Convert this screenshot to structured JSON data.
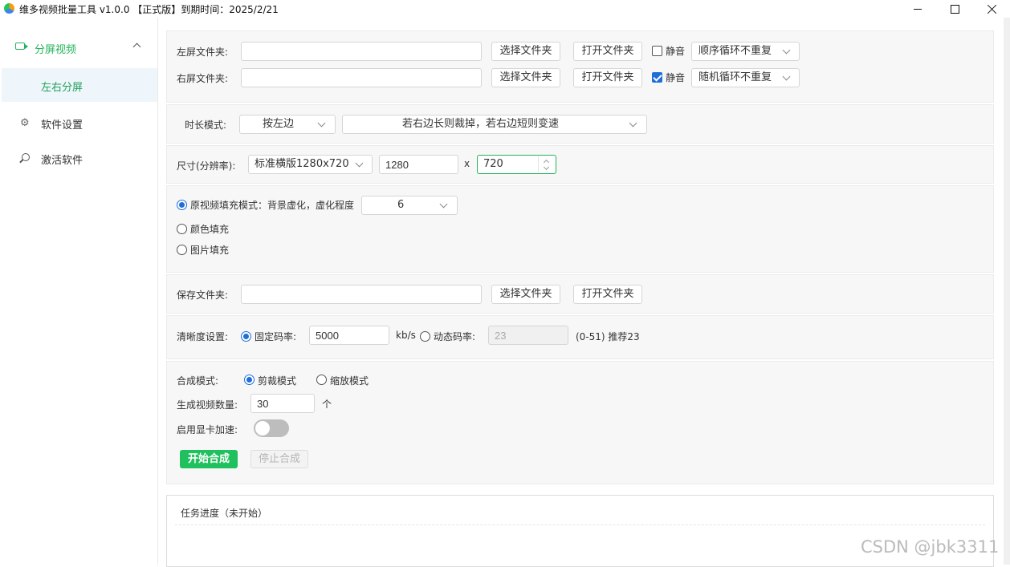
{
  "window": {
    "title": "维多视频批量工具 v1.0.0 【正式版】到期时间：2025/2/21"
  },
  "sidebar": {
    "group_label": "分屏视频",
    "sub_item_label": "左右分屏",
    "items": [
      {
        "label": "软件设置",
        "icon": "gear-icon"
      },
      {
        "label": "激活软件",
        "icon": "search-icon"
      }
    ]
  },
  "folders": {
    "left_label": "左屏文件夹:",
    "right_label": "右屏文件夹:",
    "left_value": "",
    "right_value": "",
    "choose_btn": "选择文件夹",
    "open_btn": "打开文件夹",
    "mute_label": "静音",
    "left_mute": false,
    "right_mute": true,
    "left_order": "顺序循环不重复",
    "right_order": "随机循环不重复"
  },
  "duration": {
    "label": "时长模式:",
    "mode": "按左边",
    "rule": "若右边长则裁掉，若右边短则变速"
  },
  "size": {
    "label": "尺寸(分辨率):",
    "preset": "标准横版1280x720",
    "width": "1280",
    "x_sep": "x",
    "height": "720"
  },
  "fill": {
    "option1": "原视频填充模式：背景虚化，虚化程度",
    "blur_level": "6",
    "option2": "颜色填充",
    "option3": "图片填充",
    "selected": 1
  },
  "save": {
    "label": "保存文件夹:",
    "value": "",
    "choose_btn": "选择文件夹",
    "open_btn": "打开文件夹"
  },
  "quality": {
    "label": "清晰度设置:",
    "fixed_label": "固定码率:",
    "fixed_value": "5000",
    "unit": "kb/s",
    "dynamic_label": "动态码率:",
    "dynamic_value": "23",
    "hint": "(0-51) 推荐23"
  },
  "compose": {
    "mode_label": "合成模式:",
    "mode_crop": "剪裁模式",
    "mode_scale": "缩放模式",
    "count_label": "生成视频数量:",
    "count_value": "30",
    "count_unit": "个",
    "gpu_label": "启用显卡加速:",
    "gpu_enabled": false,
    "start_btn": "开始合成",
    "stop_btn": "停止合成"
  },
  "progress": {
    "header": "任务进度（未开始）"
  },
  "watermark": "CSDN @jbk3311",
  "colors": {
    "accent": "#22b35a",
    "primary_button": "#1fc05d",
    "checkbox_blue": "#1e6fd9"
  }
}
